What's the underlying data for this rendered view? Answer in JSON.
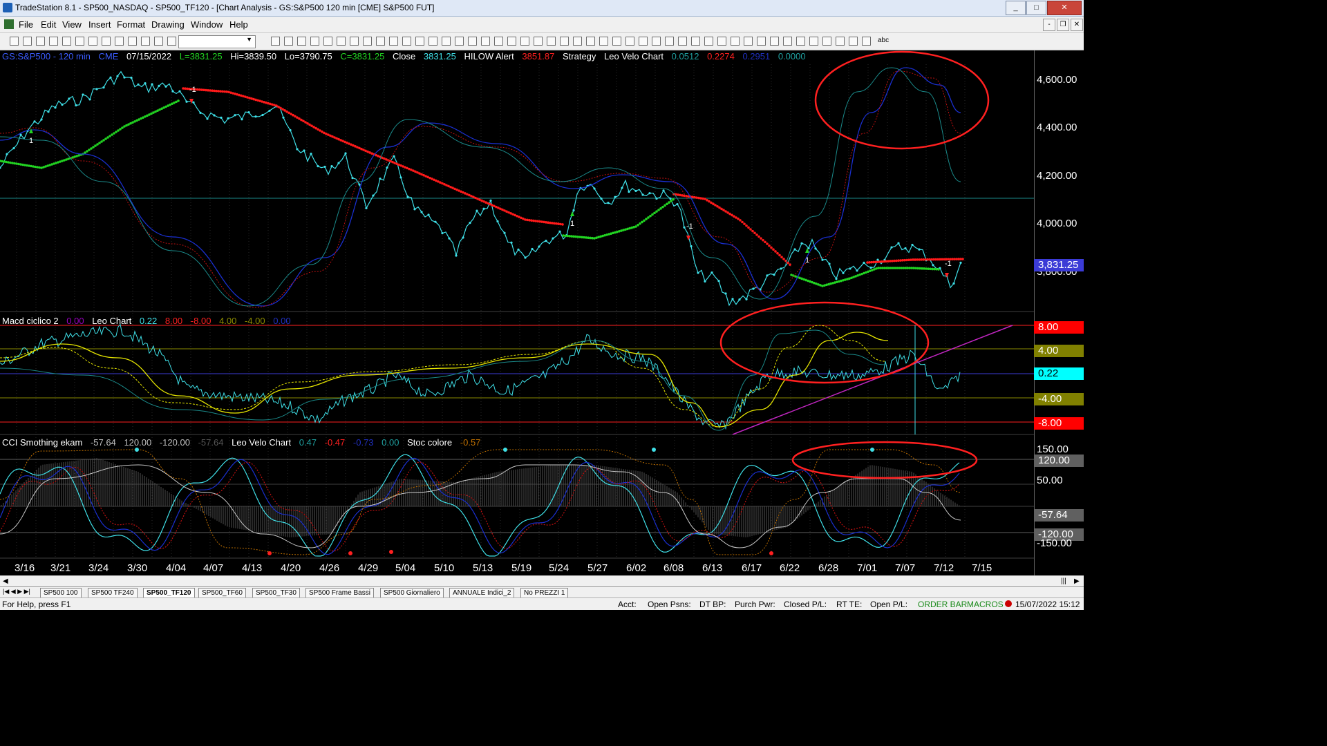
{
  "window": {
    "title": "TradeStation 8.1 - SP500_NASDAQ - SP500_TF120 - [Chart Analysis - GS:S&P500  120 min  [CME] S&P500 FUT]",
    "min_label": "_",
    "max_label": "□",
    "close_label": "✕"
  },
  "menu": [
    "File",
    "Edit",
    "View",
    "Insert",
    "Format",
    "Drawing",
    "Window",
    "Help"
  ],
  "mdi_buttons": [
    "-",
    "❐",
    "✕"
  ],
  "toolbar": {
    "text_tool": "abc"
  },
  "chart": {
    "info_line": {
      "symbol": "GS:S&P500 - 120 min",
      "exchange": "CME",
      "date": "07/15/2022",
      "last": "L=3831.25",
      "hi": "Hi=3839.50",
      "lo": "Lo=3790.75",
      "close": "C=3831.25",
      "close_label": "Close",
      "close_value": "3831.25",
      "hilow_label": "HILOW Alert",
      "hilow_value": "3851.87",
      "strategy_label": "Strategy",
      "leo_label": "Leo Velo Chart",
      "leo_v1": "0.0512",
      "leo_v2": "0.2274",
      "leo_v3": "0.2951",
      "leo_v4": "0.0000"
    },
    "macd_line": {
      "label": "Macd ciclico 2",
      "v1": "0.00",
      "leo_label": "Leo Chart",
      "v2": "0.22",
      "v3": "8.00",
      "v4": "-8.00",
      "v5": "4.00",
      "v6": "-4.00",
      "v7": "0.00"
    },
    "cci_line": {
      "label": "CCI Smothing ekam",
      "v1": "-57.64",
      "v2": "120.00",
      "v3": "-120.00",
      "v4": "-57.64",
      "leo_label": "Leo Velo Chart",
      "v5": "0.47",
      "v6": "-0.47",
      "v7": "-0.73",
      "v8": "0.00",
      "stoc_label": "Stoc colore",
      "v9": "-0.57"
    },
    "price_axis": [
      "4,600.00",
      "4,400.00",
      "4,200.00",
      "4,000.00",
      "3,800.00"
    ],
    "price_badge": "3,831.25",
    "macd_axis": {
      "p8": "8.00",
      "p4": "4.00",
      "cur": "0.22",
      "m4": "-4.00",
      "m8": "-8.00"
    },
    "cci_axis": {
      "p150": "150.00",
      "p120": "120.00",
      "p50": "50.00",
      "cur": "-57.64",
      "m120": "-120.00",
      "m150": "-150.00"
    },
    "x_axis": [
      "3/16",
      "3/21",
      "3/24",
      "3/30",
      "4/04",
      "4/07",
      "4/13",
      "4/20",
      "4/26",
      "4/29",
      "5/04",
      "5/10",
      "5/13",
      "5/19",
      "5/24",
      "5/27",
      "6/02",
      "6/08",
      "6/13",
      "6/17",
      "6/22",
      "6/28",
      "7/01",
      "7/07",
      "7/12",
      "7/15"
    ],
    "markers": [
      "1",
      "-1",
      "1",
      "-1",
      "1",
      "-1"
    ],
    "colors": {
      "price": "#3fe0e8",
      "support": "#22d422",
      "resistance": "#ff1a1a",
      "grid_red": "#ff2020",
      "grid_olive": "#8a8a00",
      "osc_yellow": "#e6e600",
      "trend": "#c026c0",
      "circle": "#ff2020",
      "badge_cyan": "#00ffff",
      "badge_red": "#ff0000",
      "badge_olive": "#808000"
    }
  },
  "tabs": [
    "SP500 100",
    "SP500 TF240",
    "SP500_TF120",
    "SP500_TF60",
    "SP500_TF30",
    "SP500 Frame Bassi",
    "SP500 Giornaliero",
    "ANNUALE Indici_2",
    "No PREZZI 1"
  ],
  "active_tab": "SP500_TF120",
  "status": {
    "help": "For Help, press F1",
    "acct": "Acct:",
    "open_psns": "Open Psns:",
    "dt_bp": "DT BP:",
    "purch_pwr": "Purch Pwr:",
    "closed_pl": "Closed P/L:",
    "rt_te": "RT TE:",
    "open_pl": "Open P/L:",
    "order_bar": "ORDER BAR",
    "macros": "MACROS",
    "datetime": "15/07/2022 15:12"
  }
}
